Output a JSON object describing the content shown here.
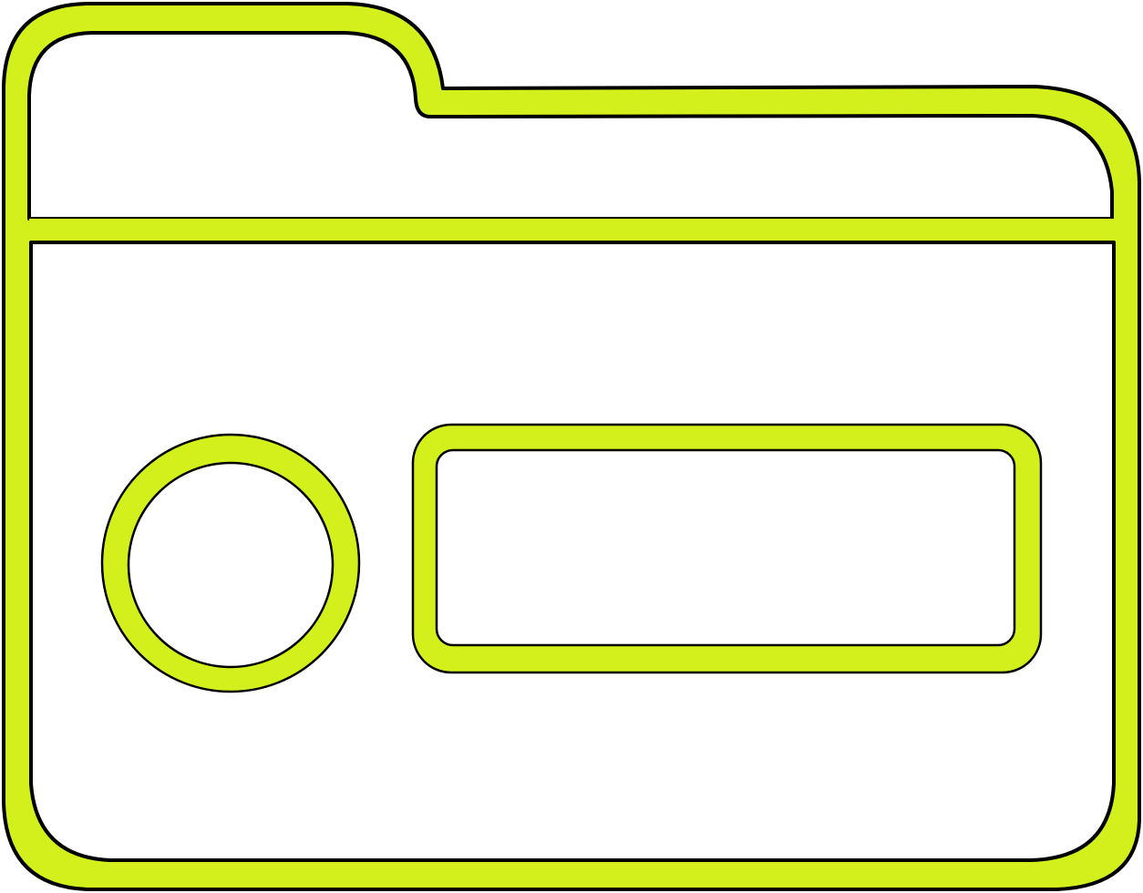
{
  "icon": {
    "name": "folder-icon",
    "fill_color": "#d4f01c",
    "outline_color": "#000000",
    "background_color": "#ffffff",
    "parts": [
      "folder-body",
      "folder-tab-divider",
      "circle-badge",
      "label-rectangle"
    ]
  }
}
